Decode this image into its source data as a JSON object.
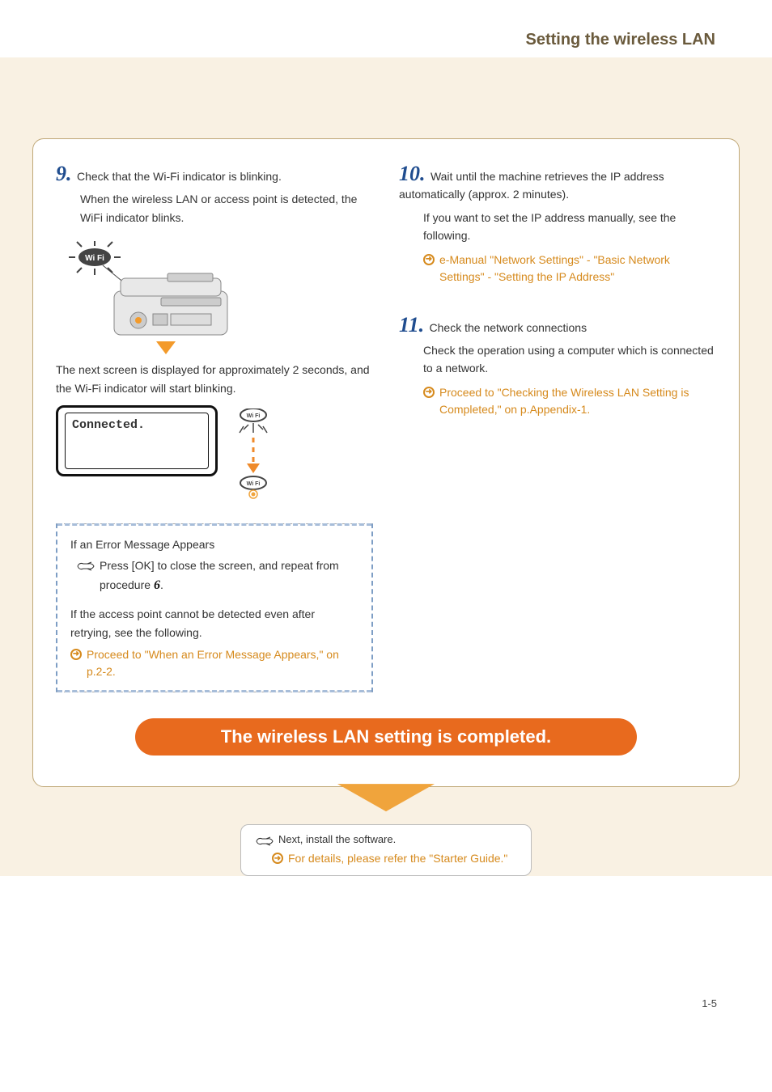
{
  "header": {
    "title": "Setting the wireless LAN"
  },
  "left": {
    "step9": {
      "num": "9.",
      "text": "Check that the Wi-Fi indicator is blinking.",
      "sub": "When the wireless LAN or access point is detected, the WiFi indicator blinks."
    },
    "caption_after_printer": "The next screen is displayed for approximately 2 seconds, and the Wi-Fi indicator will start blinking.",
    "lcd_text": "Connected.",
    "info": {
      "title1": "If an Error Message Appears",
      "line1_pre": "Press [OK] to close the screen, and repeat from procedure ",
      "line1_num": "6",
      "line1_post": ".",
      "title2": "If the access point cannot be detected even after retrying, see the following.",
      "ref": "Proceed to \"When an Error Message Appears,\" on p.2-2."
    }
  },
  "right": {
    "step10": {
      "num": "10.",
      "text": "Wait until the machine retrieves the IP address automatically (approx. 2 minutes).",
      "sub": "If you want to set the IP address manually, see the following.",
      "ref": "e-Manual \"Network Settings\" - \"Basic Network Settings\" - \"Setting the IP Address\""
    },
    "step11": {
      "num": "11.",
      "text": "Check the network connections",
      "sub": "Check the operation using a computer which is connected to a network.",
      "ref": "Proceed to \"Checking the Wireless LAN Setting is Completed,\" on p.Appendix-1."
    }
  },
  "banner": "The wireless LAN setting is completed.",
  "next": {
    "line": "Next, install the software.",
    "ref": "For details, please refer the \"Starter Guide.\""
  },
  "page_number": "1-5",
  "icons": {
    "wifi_label": "Wi Fi"
  }
}
